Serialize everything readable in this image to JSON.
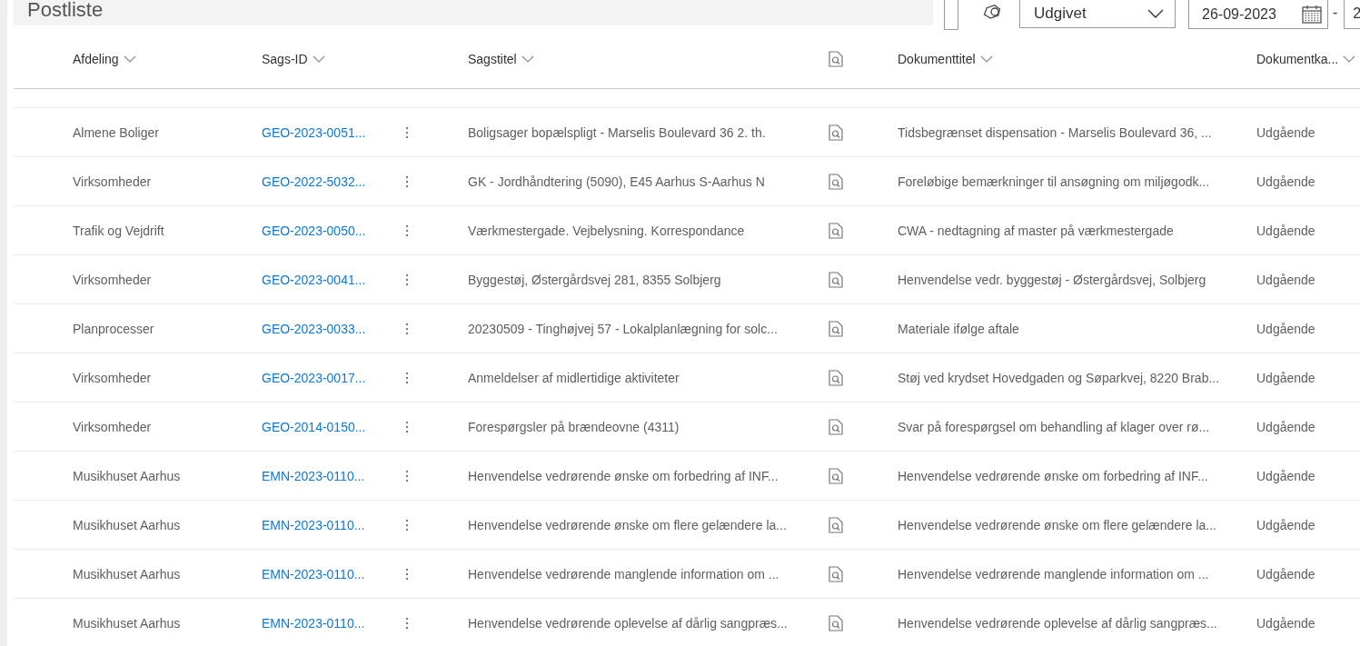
{
  "page_title": "Postliste",
  "toolbar": {
    "filter_select": {
      "value": "Udgivet"
    },
    "date_from": {
      "value": "26-09-2023"
    },
    "date_separator": "-",
    "date_to": {
      "value": "2"
    }
  },
  "table": {
    "columns": [
      {
        "label": "Afdeling",
        "kind": "text"
      },
      {
        "label": "Sags-ID",
        "kind": "text"
      },
      {
        "kind": "spacer"
      },
      {
        "label": "Sagstitel",
        "kind": "text"
      },
      {
        "kind": "preview-icon"
      },
      {
        "label": "Dokumenttitel",
        "kind": "text"
      },
      {
        "label": "Dokumentka...",
        "kind": "text"
      }
    ],
    "rows": [
      {
        "afdeling": "Almene Boliger",
        "sags_id": "GEO-2023-0051...",
        "sagstitel": "Boligsager bopælspligt - Marselis Boulevard 36 2. th.",
        "dokumenttitel": "Tidsbegrænset dispensation - Marselis Boulevard 36, ...",
        "dokumentkategori": "Udgående"
      },
      {
        "afdeling": "Virksomheder",
        "sags_id": "GEO-2022-5032...",
        "sagstitel": "GK - Jordhåndtering (5090), E45 Aarhus S-Aarhus N",
        "dokumenttitel": "Foreløbige bemærkninger til ansøgning om miljøgodk...",
        "dokumentkategori": "Udgående"
      },
      {
        "afdeling": "Trafik og Vejdrift",
        "sags_id": "GEO-2023-0050...",
        "sagstitel": "Værkmestergade. Vejbelysning. Korrespondance",
        "dokumenttitel": "CWA - nedtagning af master på værkmestergade",
        "dokumentkategori": "Udgående"
      },
      {
        "afdeling": "Virksomheder",
        "sags_id": "GEO-2023-0041...",
        "sagstitel": "Byggestøj, Østergårdsvej 281, 8355 Solbjerg",
        "dokumenttitel": "Henvendelse vedr. byggestøj - Østergårdsvej, Solbjerg",
        "dokumentkategori": "Udgående"
      },
      {
        "afdeling": "Planprocesser",
        "sags_id": "GEO-2023-0033...",
        "sagstitel": "20230509 - Tinghøjvej 57 - Lokalplanlægning for solc...",
        "dokumenttitel": "Materiale ifølge aftale",
        "dokumentkategori": "Udgående"
      },
      {
        "afdeling": "Virksomheder",
        "sags_id": "GEO-2023-0017...",
        "sagstitel": "Anmeldelser af midlertidige aktiviteter",
        "dokumenttitel": "Støj ved krydset Hovedgaden og Søparkvej, 8220 Brab...",
        "dokumentkategori": "Udgående"
      },
      {
        "afdeling": "Virksomheder",
        "sags_id": "GEO-2014-0150...",
        "sagstitel": "Forespørgsler på brændeovne (4311)",
        "dokumenttitel": "Svar på forespørgsel om behandling af klager over rø...",
        "dokumentkategori": "Udgående"
      },
      {
        "afdeling": "Musikhuset Aarhus",
        "sags_id": "EMN-2023-0110...",
        "sagstitel": "Henvendelse vedrørende ønske om forbedring af INF...",
        "dokumenttitel": "Henvendelse vedrørende ønske om forbedring af INF...",
        "dokumentkategori": "Udgående"
      },
      {
        "afdeling": "Musikhuset Aarhus",
        "sags_id": "EMN-2023-0110...",
        "sagstitel": "Henvendelse vedrørende ønske om flere gelændere la...",
        "dokumenttitel": "Henvendelse vedrørende ønske om flere gelændere la...",
        "dokumentkategori": "Udgående"
      },
      {
        "afdeling": "Musikhuset Aarhus",
        "sags_id": "EMN-2023-0110...",
        "sagstitel": "Henvendelse vedrørende manglende information om ...",
        "dokumenttitel": "Henvendelse vedrørende manglende information om ...",
        "dokumentkategori": "Udgående"
      },
      {
        "afdeling": "Musikhuset Aarhus",
        "sags_id": "EMN-2023-0110...",
        "sagstitel": "Henvendelse vedrørende oplevelse af dårlig sangpræs...",
        "dokumenttitel": "Henvendelse vedrørende oplevelse af dårlig sangpræs...",
        "dokumentkategori": "Udgående"
      }
    ]
  }
}
